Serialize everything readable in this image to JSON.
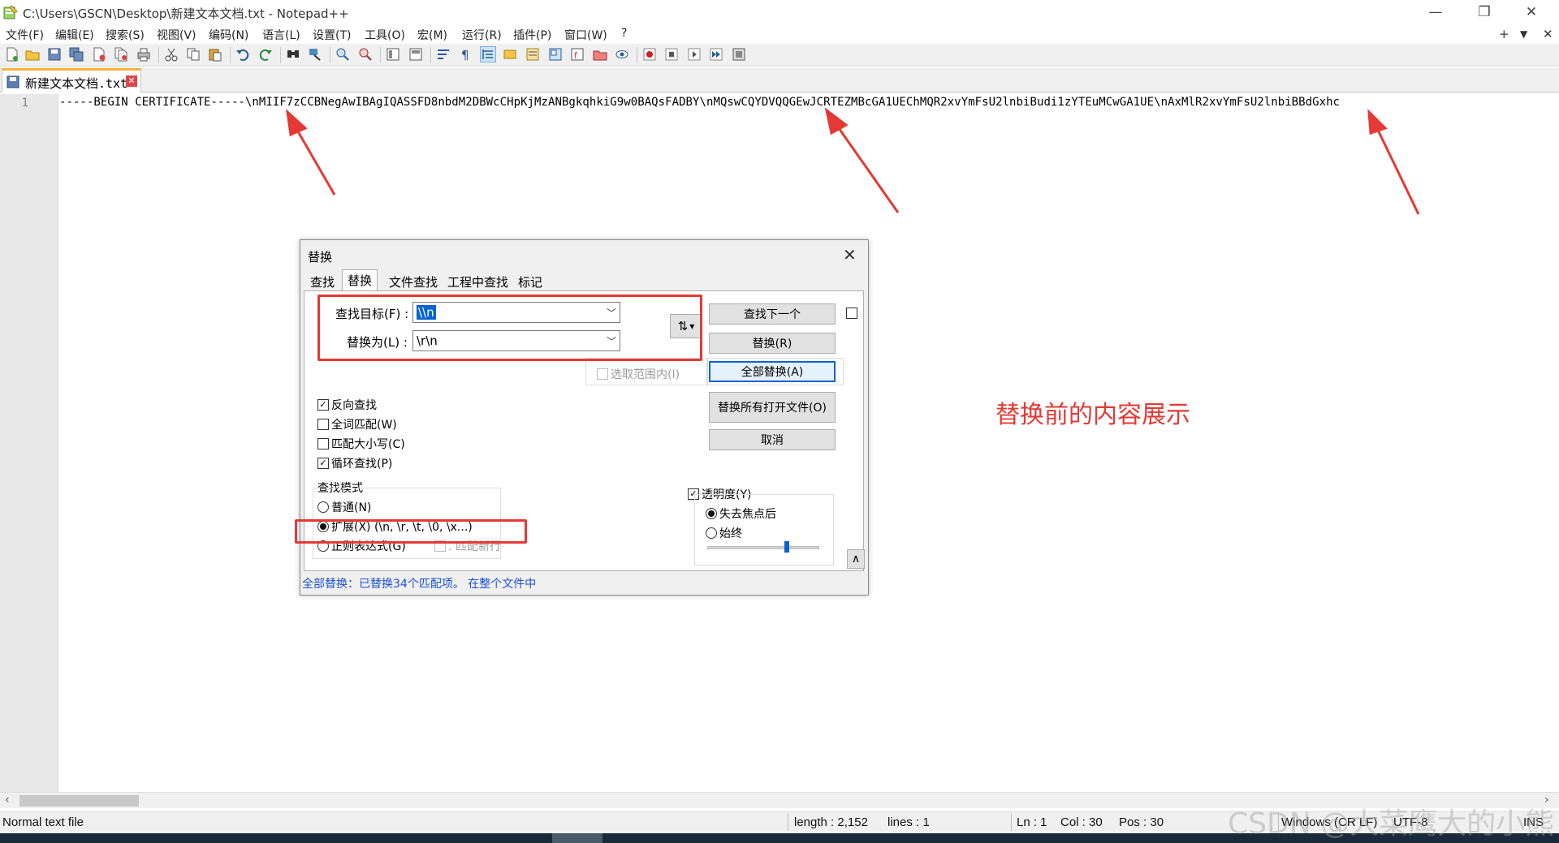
{
  "window": {
    "title": "C:\\Users\\GSCN\\Desktop\\新建文本文档.txt - Notepad++",
    "minimize": "—",
    "restore": "❐",
    "close": "✕"
  },
  "menu": {
    "items": [
      "文件(F)",
      "编辑(E)",
      "搜索(S)",
      "视图(V)",
      "编码(N)",
      "语言(L)",
      "设置(T)",
      "工具(O)",
      "宏(M)",
      "运行(R)",
      "插件(P)",
      "窗口(W)",
      "?"
    ],
    "right": {
      "add": "+",
      "dropdown": "▼",
      "close": "✕"
    }
  },
  "tab": {
    "label": "新建文本文档.txt",
    "close": "✕"
  },
  "editor": {
    "line_number": "1",
    "line_text": "-----BEGIN CERTIFICATE-----\\nMIIF7zCCBNegAwIBAgIQASSFD8nbdM2DBWcCHpKjMzANBgkqhkiG9w0BAQsFADBY\\nMQswCQYDVQQGEwJCRTEZMBcGA1UEChMQR2xvYmFsU2lnbiBudi1zYTEuMCwGA1UE\\nAxMlR2xvYmFsU2lnbiBBdGxhc"
  },
  "annotation": {
    "text": "替换前的内容展示",
    "color": "#e53935"
  },
  "dialog": {
    "title": "替换",
    "close": "✕",
    "tabs": [
      "查找",
      "替换",
      "文件查找",
      "工程中查找",
      "标记"
    ],
    "active_tab": "替换",
    "find_label": "查找目标(F) :",
    "find_value": "\\\\n",
    "replace_label": "替换为(L) :",
    "replace_value": "\\r\\n",
    "swap_icon": "⇅",
    "swap_dropdown": "▾",
    "buttons": {
      "find_next": "查找下一个",
      "replace": "替换(R)",
      "replace_all": "全部替换(A)",
      "replace_all_open": "替换所有打开文件(O)",
      "cancel": "取消",
      "expand": "∧"
    },
    "in_selection": "选取范围内(I)",
    "options": [
      {
        "label": "反向查找",
        "checked": true
      },
      {
        "label": "全词匹配(W)",
        "checked": false
      },
      {
        "label": "匹配大小写(C)",
        "checked": false
      },
      {
        "label": "循环查找(P)",
        "checked": true
      }
    ],
    "search_mode": {
      "title": "查找模式",
      "normal": "普通(N)",
      "extended": "扩展(X) (\\n, \\r, \\t, \\0, \\x...)",
      "regex": "正则表达式(G)",
      "dot_newline": ". 匹配新行",
      "selected": "extended"
    },
    "transparency": {
      "label": "透明度(Y)",
      "checked": true,
      "on_lose_focus": "失去焦点后",
      "always": "始终",
      "selected": "on_lose_focus",
      "level": 0.72
    },
    "status": "全部替换：已替换34个匹配项。 在整个文件中"
  },
  "status_bar": {
    "file_type": "Normal text file",
    "length": "length : 2,152",
    "lines": "lines : 1",
    "ln": "Ln : 1",
    "col": "Col : 30",
    "pos": "Pos : 30",
    "eol": "Windows (CR LF)",
    "encoding": "UTF-8",
    "mode": "INS"
  },
  "watermark": "CSDN @大菜鹰大的小熊",
  "colors": {
    "highlight": "#e53935",
    "accent": "#0a64d0",
    "tab_top": "#fcb040"
  }
}
